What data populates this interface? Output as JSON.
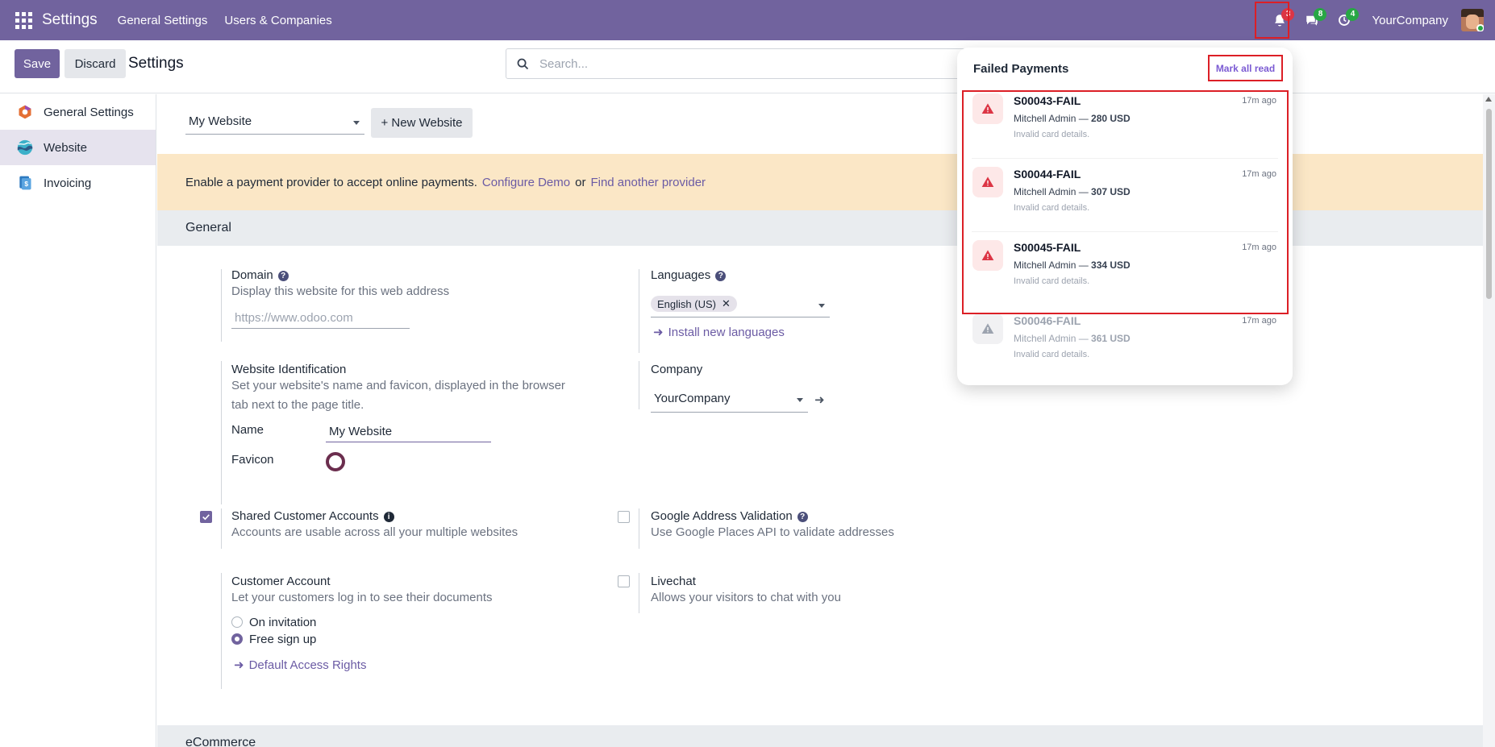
{
  "navbar": {
    "app_title": "Settings",
    "menu": [
      "General Settings",
      "Users & Companies"
    ],
    "notifications_count": "3",
    "messages_count": "8",
    "activities_count": "4",
    "company": "YourCompany"
  },
  "control_panel": {
    "save_label": "Save",
    "discard_label": "Discard",
    "title": "Settings",
    "search_placeholder": "Search..."
  },
  "sidebar": {
    "items": [
      {
        "label": "General Settings"
      },
      {
        "label": "Website"
      },
      {
        "label": "Invoicing"
      }
    ]
  },
  "website": {
    "selected": "My Website",
    "new_button": "+ New Website"
  },
  "alert": {
    "text": "Enable a payment provider to accept online payments.",
    "link1": "Configure Demo",
    "or": "or",
    "link2": "Find another provider"
  },
  "sections": {
    "general": "General",
    "ecommerce": "eCommerce"
  },
  "settings": {
    "domain": {
      "label": "Domain",
      "desc": "Display this website for this web address",
      "placeholder": "https://www.odoo.com"
    },
    "languages": {
      "label": "Languages",
      "tag": "English (US)",
      "link": "Install new languages"
    },
    "identification": {
      "label": "Website Identification",
      "desc": "Set your website's name and favicon, displayed in the browser tab next to the page title.",
      "name_label": "Name",
      "name_value": "My Website",
      "favicon_label": "Favicon"
    },
    "company": {
      "label": "Company",
      "value": "YourCompany"
    },
    "shared_accounts": {
      "label": "Shared Customer Accounts",
      "desc": "Accounts are usable across all your multiple websites"
    },
    "google_address": {
      "label": "Google Address Validation",
      "desc": "Use Google Places API to validate addresses"
    },
    "customer_account": {
      "label": "Customer Account",
      "desc": "Let your customers log in to see their documents",
      "opt1": "On invitation",
      "opt2": "Free sign up",
      "link": "Default Access Rights"
    },
    "livechat": {
      "label": "Livechat",
      "desc": "Allows your visitors to chat with you"
    }
  },
  "notifications": {
    "title": "Failed Payments",
    "mark_all_read": "Mark all read",
    "items": [
      {
        "title": "S00043-FAIL",
        "time": "17m ago",
        "who": "Mitchell Admin — ",
        "amount": "280 USD",
        "msg": "Invalid card details."
      },
      {
        "title": "S00044-FAIL",
        "time": "17m ago",
        "who": "Mitchell Admin — ",
        "amount": "307 USD",
        "msg": "Invalid card details."
      },
      {
        "title": "S00045-FAIL",
        "time": "17m ago",
        "who": "Mitchell Admin — ",
        "amount": "334 USD",
        "msg": "Invalid card details."
      },
      {
        "title": "S00046-FAIL",
        "time": "17m ago",
        "who": "Mitchell Admin — ",
        "amount": "361 USD",
        "msg": "Invalid card details."
      }
    ]
  }
}
